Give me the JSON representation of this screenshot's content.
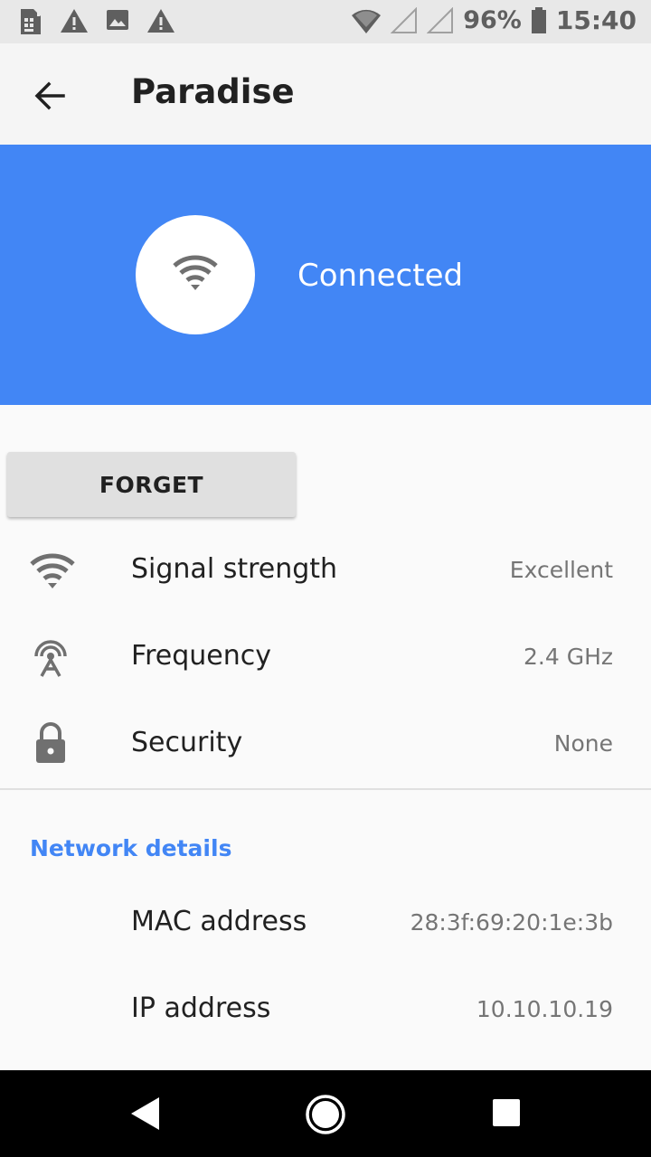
{
  "status_bar": {
    "battery": "96%",
    "time": "15:40",
    "icons": [
      "sim-alert-icon",
      "warning-icon",
      "image-icon",
      "warning-icon",
      "wifi-icon",
      "signal-empty-icon",
      "signal-empty-icon",
      "battery-icon"
    ]
  },
  "app_bar": {
    "title": "Paradise",
    "back_icon": "arrow-back-icon"
  },
  "hero": {
    "status": "Connected",
    "icon": "wifi-icon",
    "color": "#4286f5"
  },
  "actions": {
    "forget_label": "FORGET"
  },
  "info": [
    {
      "label": "Signal strength",
      "value": "Excellent",
      "icon": "wifi-signal-icon"
    },
    {
      "label": "Frequency",
      "value": "2.4 GHz",
      "icon": "antenna-icon"
    },
    {
      "label": "Security",
      "value": "None",
      "icon": "lock-icon"
    }
  ],
  "network_details": {
    "header": "Network details",
    "rows": [
      {
        "label": "MAC address",
        "value": "28:3f:69:20:1e:3b"
      },
      {
        "label": "IP address",
        "value": "10.10.10.19"
      }
    ]
  },
  "nav_bar": {
    "icons": [
      "back-triangle-icon",
      "home-circle-icon",
      "recents-square-icon"
    ]
  }
}
